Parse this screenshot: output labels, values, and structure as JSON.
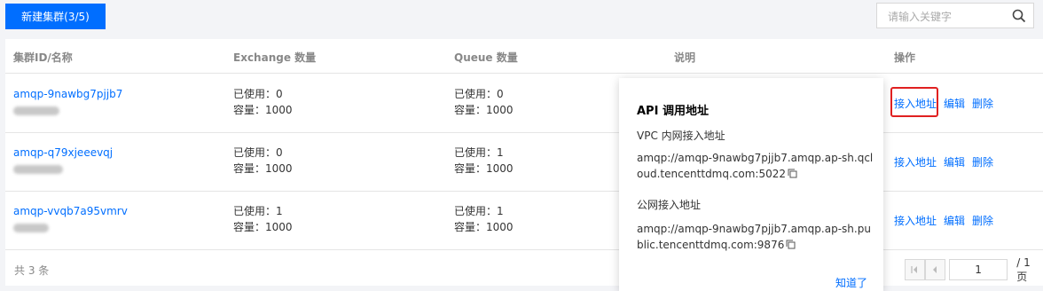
{
  "toolbar": {
    "new_cluster_label": "新建集群(3/5)",
    "search_placeholder": "请输入关键字"
  },
  "table": {
    "headers": [
      "集群ID/名称",
      "Exchange 数量",
      "Queue 数量",
      "说明",
      "操作"
    ],
    "rows": [
      {
        "id": "amqp-9nawbg7pjjb7",
        "exchange_used": "已使用：0",
        "exchange_capacity": "容量：1000",
        "queue_used": "已使用：0",
        "queue_capacity": "容量：1000",
        "ops": [
          "接入地址",
          "编辑",
          "删除"
        ]
      },
      {
        "id": "amqp-q79xjeeevqj",
        "exchange_used": "已使用：0",
        "exchange_capacity": "容量：1000",
        "queue_used": "已使用：1",
        "queue_capacity": "容量：1000",
        "ops": [
          "接入地址",
          "编辑",
          "删除"
        ]
      },
      {
        "id": "amqp-vvqb7a95vmrv",
        "exchange_used": "已使用：1",
        "exchange_capacity": "容量：1000",
        "queue_used": "已使用：1",
        "queue_capacity": "容量：1000",
        "ops": [
          "接入地址",
          "编辑",
          "删除"
        ]
      }
    ]
  },
  "footer": {
    "total_label": "共 3 条",
    "page_value": "1",
    "page_total": "/ 1 页"
  },
  "popover": {
    "title": "API 调用地址",
    "vpc_label": "VPC 内网接入地址",
    "vpc_address": "amqp://amqp-9nawbg7pjjb7.amqp.ap-sh.qcloud.tencenttdmq.com:5022",
    "public_label": "公网接入地址",
    "public_address": "amqp://amqp-9nawbg7pjjb7.amqp.ap-sh.public.tencenttdmq.com:9876",
    "ok_label": "知道了"
  },
  "colors": {
    "primary": "#006eff",
    "highlight": "#e02020"
  }
}
